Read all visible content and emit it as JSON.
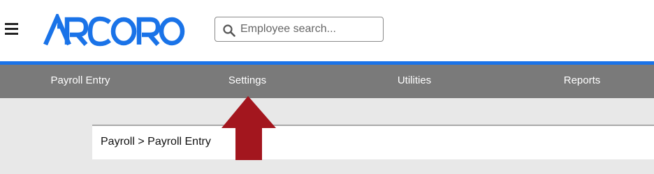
{
  "logo": {
    "text": "ARCORO",
    "color": "#1a73e8"
  },
  "search": {
    "placeholder": "Employee search..."
  },
  "nav": {
    "items": [
      {
        "label": "Payroll Entry"
      },
      {
        "label": "Settings"
      },
      {
        "label": "Utilities"
      },
      {
        "label": "Reports"
      }
    ]
  },
  "breadcrumb": {
    "text": "Payroll > Payroll Entry"
  },
  "colors": {
    "brand": "#1a73e8",
    "nav_bg": "#7a7a7a",
    "arrow": "#a3161e"
  },
  "icons": {
    "menu": "hamburger-icon",
    "search": "search-icon",
    "arrow": "up-arrow-annotation"
  }
}
